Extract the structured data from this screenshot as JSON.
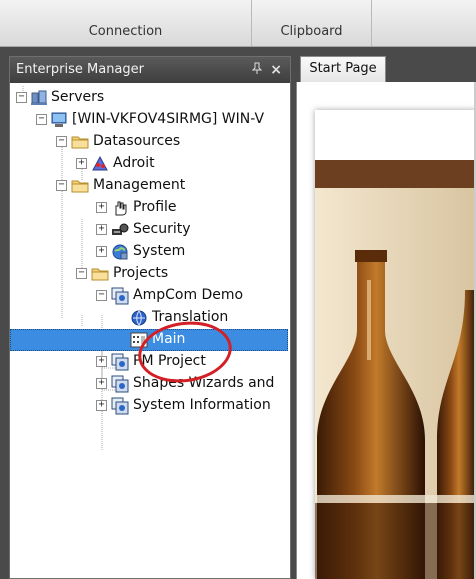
{
  "ribbon": {
    "tabs": [
      {
        "label": "Connection"
      },
      {
        "label": "Clipboard"
      }
    ]
  },
  "panel": {
    "title": "Enterprise Manager",
    "pin_glyph": "⬇",
    "close_glyph": "×"
  },
  "tree": {
    "servers": "Servers",
    "server": "[WIN-VKFOV4SIRMG] WIN-V",
    "datasources": "Datasources",
    "adroit": "Adroit",
    "management": "Management",
    "profile": "Profile",
    "security": "Security",
    "system": "System",
    "projects": "Projects",
    "ampcom_demo": "AmpCom Demo",
    "translation": "Translation",
    "main": "Main",
    "pm_project": "PM Project",
    "shapes_wizards": "Shapes Wizards and",
    "system_information": "System Information"
  },
  "document": {
    "tab_label": "Start Page"
  },
  "colors": {
    "selection": "#3c8de2",
    "annotation": "#d32026",
    "panel_header": "#4b4b4b",
    "banner": "#6b3f20"
  }
}
